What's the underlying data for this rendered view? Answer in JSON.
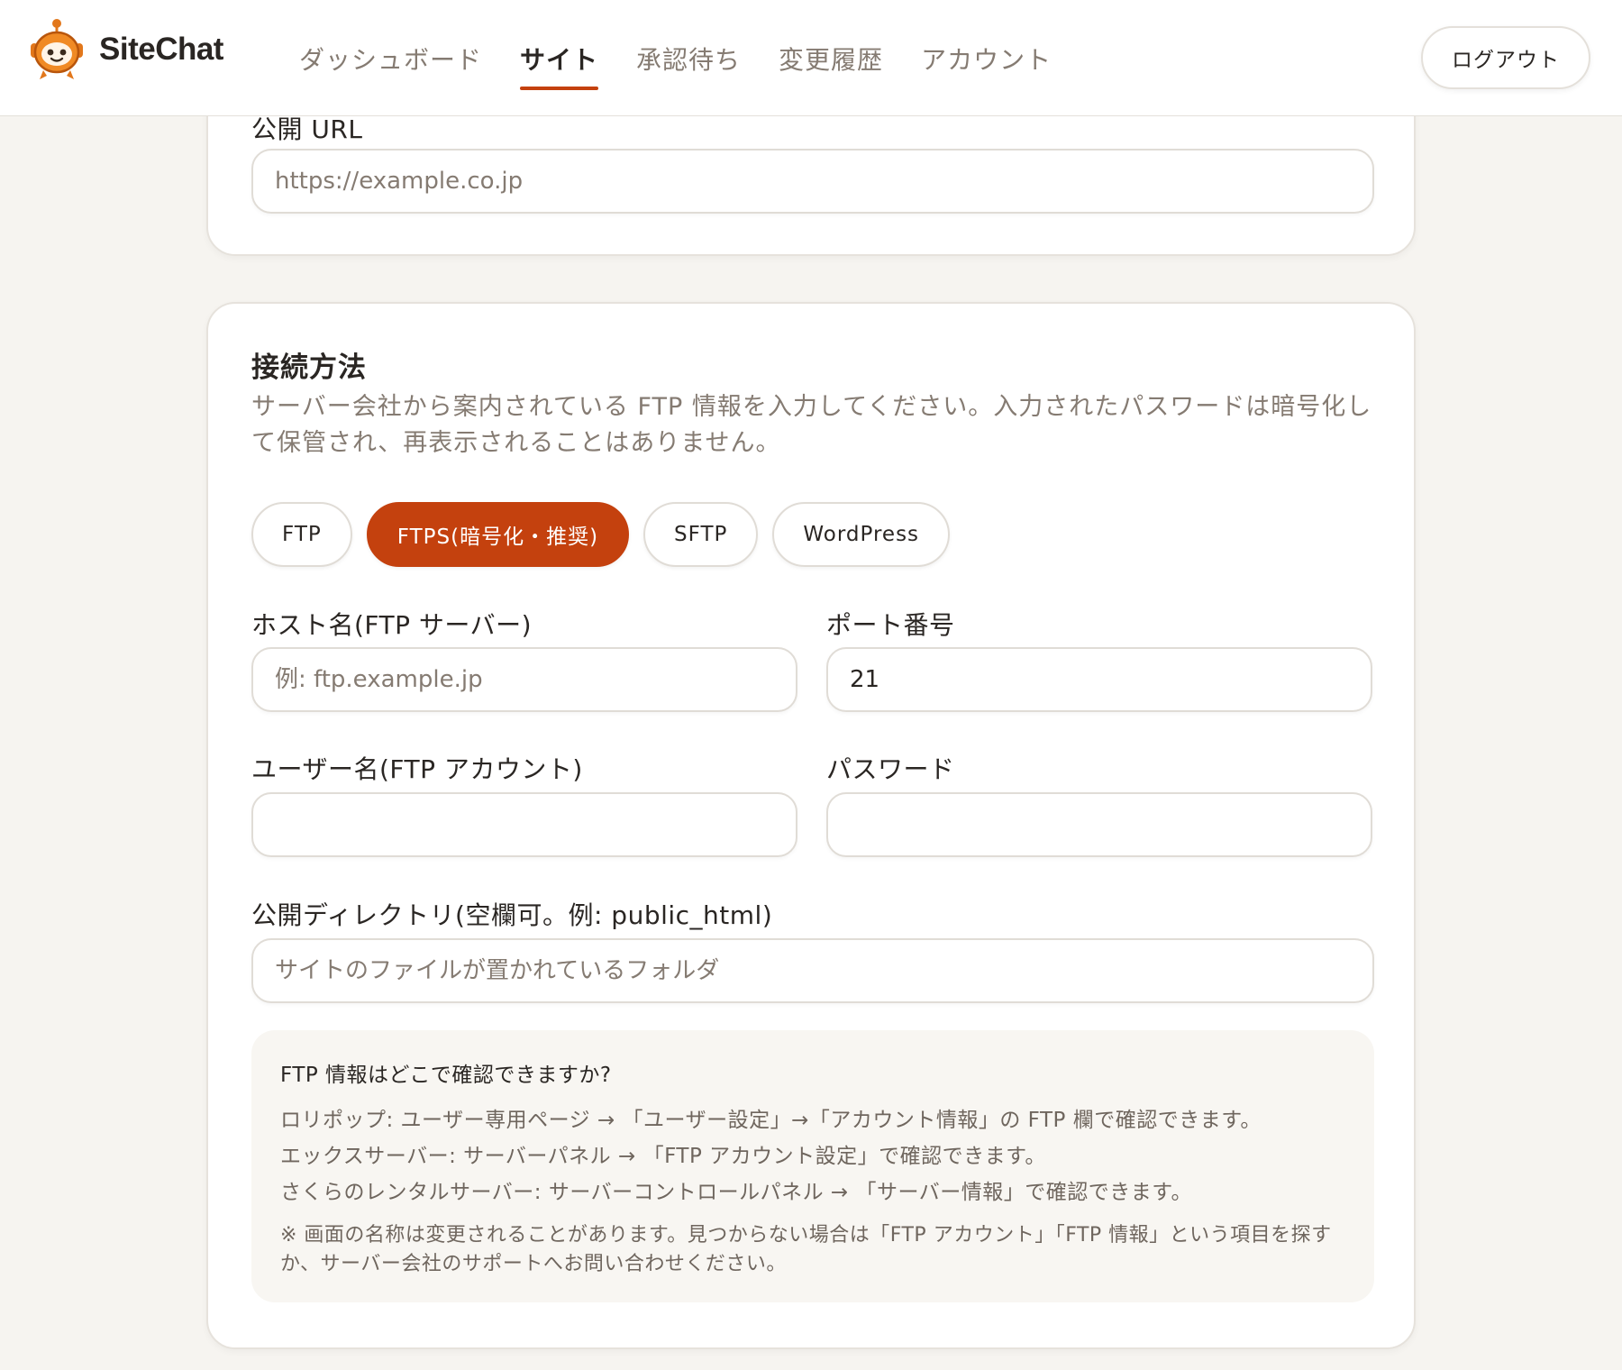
{
  "app": {
    "name": "SiteChat"
  },
  "nav": {
    "tabs": [
      {
        "label": "ダッシュボード",
        "active": false
      },
      {
        "label": "サイト",
        "active": true
      },
      {
        "label": "承認待ち",
        "active": false
      },
      {
        "label": "変更履歴",
        "active": false
      },
      {
        "label": "アカウント",
        "active": false
      }
    ],
    "logout_label": "ログアウト"
  },
  "public_url": {
    "label": "公開 URL",
    "value": "",
    "placeholder": "https://example.co.jp"
  },
  "connection": {
    "title": "接続方法",
    "description": "サーバー会社から案内されている FTP 情報を入力してください。入力されたパスワードは暗号化して保管され、再表示されることはありません。",
    "methods": [
      {
        "label": "FTP",
        "active": false
      },
      {
        "label": "FTPS(暗号化・推奨)",
        "active": true
      },
      {
        "label": "SFTP",
        "active": false
      },
      {
        "label": "WordPress",
        "active": false
      }
    ],
    "host": {
      "label": "ホスト名(FTP サーバー)",
      "value": "",
      "placeholder": "例: ftp.example.jp"
    },
    "port": {
      "label": "ポート番号",
      "value": "21",
      "placeholder": ""
    },
    "username": {
      "label": "ユーザー名(FTP アカウント)",
      "value": "",
      "placeholder": ""
    },
    "password": {
      "label": "パスワード",
      "value": "",
      "placeholder": ""
    },
    "directory": {
      "label": "公開ディレクトリ(空欄可。例: public_html)",
      "value": "",
      "placeholder": "サイトのファイルが置かれているフォルダ"
    },
    "help": {
      "title": "FTP 情報はどこで確認できますか?",
      "lines": [
        "ロリポップ: ユーザー専用ページ → 「ユーザー設定」→「アカウント情報」の FTP 欄で確認できます。",
        "エックスサーバー: サーバーパネル → 「FTP アカウント設定」で確認できます。",
        "さくらのレンタルサーバー: サーバーコントロールパネル → 「サーバー情報」で確認できます。"
      ],
      "note": "※ 画面の名称は変更されることがあります。見つからない場合は「FTP アカウント」「FTP 情報」という項目を探すか、サーバー会社のサポートへお問い合わせください。"
    }
  },
  "colors": {
    "accent": "#c4410e",
    "background": "#f6f4f0",
    "text": "#2a2623",
    "muted": "#857b72"
  }
}
